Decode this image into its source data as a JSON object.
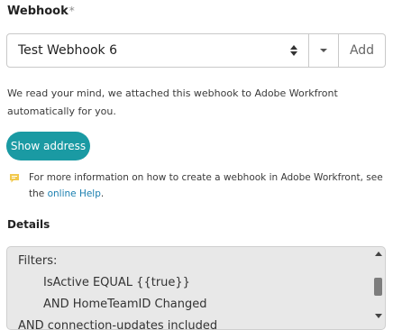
{
  "webhook": {
    "label": "Webhook",
    "required_mark": "*",
    "selected": "Test Webhook 6",
    "add_label": "Add"
  },
  "info": {
    "attached_text": "We read your mind, we attached this webhook to Adobe Workfront automatically for you."
  },
  "show_address": {
    "label": "Show address"
  },
  "help": {
    "text": "For more information on how to create a webhook in Adobe Workfront, see the ",
    "link": "online Help",
    "suffix": "."
  },
  "details": {
    "label": "Details",
    "lines": [
      "Filters:",
      "IsActive EQUAL {{true}}",
      "AND HomeTeamID Changed",
      "AND connection-updates included"
    ]
  },
  "colors": {
    "accent": "#1a9aa3",
    "link": "#1a7fb0",
    "help_icon": "#f2c94c"
  }
}
